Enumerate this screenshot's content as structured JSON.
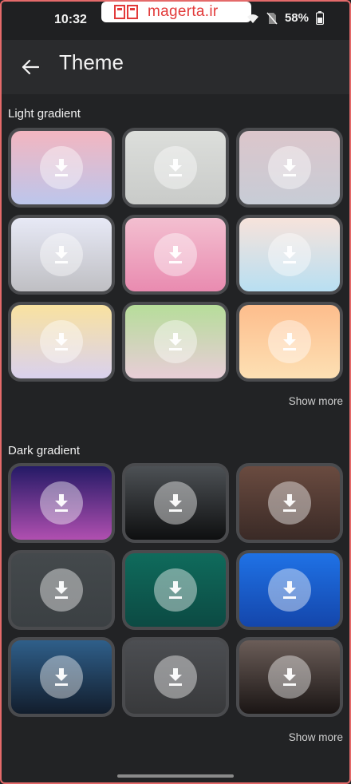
{
  "status_bar": {
    "time": "10:32",
    "battery": "58%",
    "icons": [
      "wifi-icon",
      "no-sim-icon",
      "battery-icon"
    ]
  },
  "watermark": {
    "text": "magerta.ir",
    "color": "#e23a3a",
    "logo": "book-logo"
  },
  "app_bar": {
    "back_icon": "arrow-left-icon",
    "title": "Theme"
  },
  "sections": [
    {
      "title": "Light gradient",
      "show_more": "Show more",
      "tiles": [
        {
          "name": "pink-blue",
          "gradient": [
            "#f3b6c0",
            "#bcc6ec"
          ]
        },
        {
          "name": "grey-light",
          "gradient": [
            "#dcdedb",
            "#c9cbc9"
          ]
        },
        {
          "name": "mauve-grey",
          "gradient": [
            "#dcc6cb",
            "#c7ccd6"
          ]
        },
        {
          "name": "lavender-grey",
          "gradient": [
            "#e7e9f6",
            "#bfbfc3"
          ]
        },
        {
          "name": "pink",
          "gradient": [
            "#f3bfd0",
            "#e98bb0"
          ]
        },
        {
          "name": "peach-sky",
          "gradient": [
            "#f7e3db",
            "#b8dff2"
          ]
        },
        {
          "name": "yellow-lilac",
          "gradient": [
            "#f9e2a0",
            "#d9d1ee"
          ]
        },
        {
          "name": "green-rose",
          "gradient": [
            "#b6dd9a",
            "#e8cdd7"
          ]
        },
        {
          "name": "orange-peach",
          "gradient": [
            "#fdbd8c",
            "#fde0b4"
          ]
        }
      ]
    },
    {
      "title": "Dark gradient",
      "show_more": "Show more",
      "tiles": [
        {
          "name": "indigo-magenta",
          "gradient": [
            "#241a66",
            "#b04fb0"
          ]
        },
        {
          "name": "graphite-black",
          "gradient": [
            "#4d5155",
            "#0e0f10"
          ]
        },
        {
          "name": "brown",
          "gradient": [
            "#6a4b40",
            "#3a2a26"
          ]
        },
        {
          "name": "slate",
          "gradient": [
            "#44494c",
            "#3b4043"
          ]
        },
        {
          "name": "teal",
          "gradient": [
            "#0f6b5c",
            "#0c4a43"
          ]
        },
        {
          "name": "blue",
          "gradient": [
            "#1f72e6",
            "#1446ab"
          ]
        },
        {
          "name": "navy-blue",
          "gradient": [
            "#2f5f8a",
            "#121d2c"
          ]
        },
        {
          "name": "charcoal",
          "gradient": [
            "#4c4e52",
            "#38393b"
          ]
        },
        {
          "name": "umber-black",
          "gradient": [
            "#6b5d58",
            "#1a1514"
          ]
        }
      ]
    }
  ],
  "colors": {
    "background": "#222325",
    "app_bar": "#2a2b2d",
    "frame": "#e46a6a"
  }
}
